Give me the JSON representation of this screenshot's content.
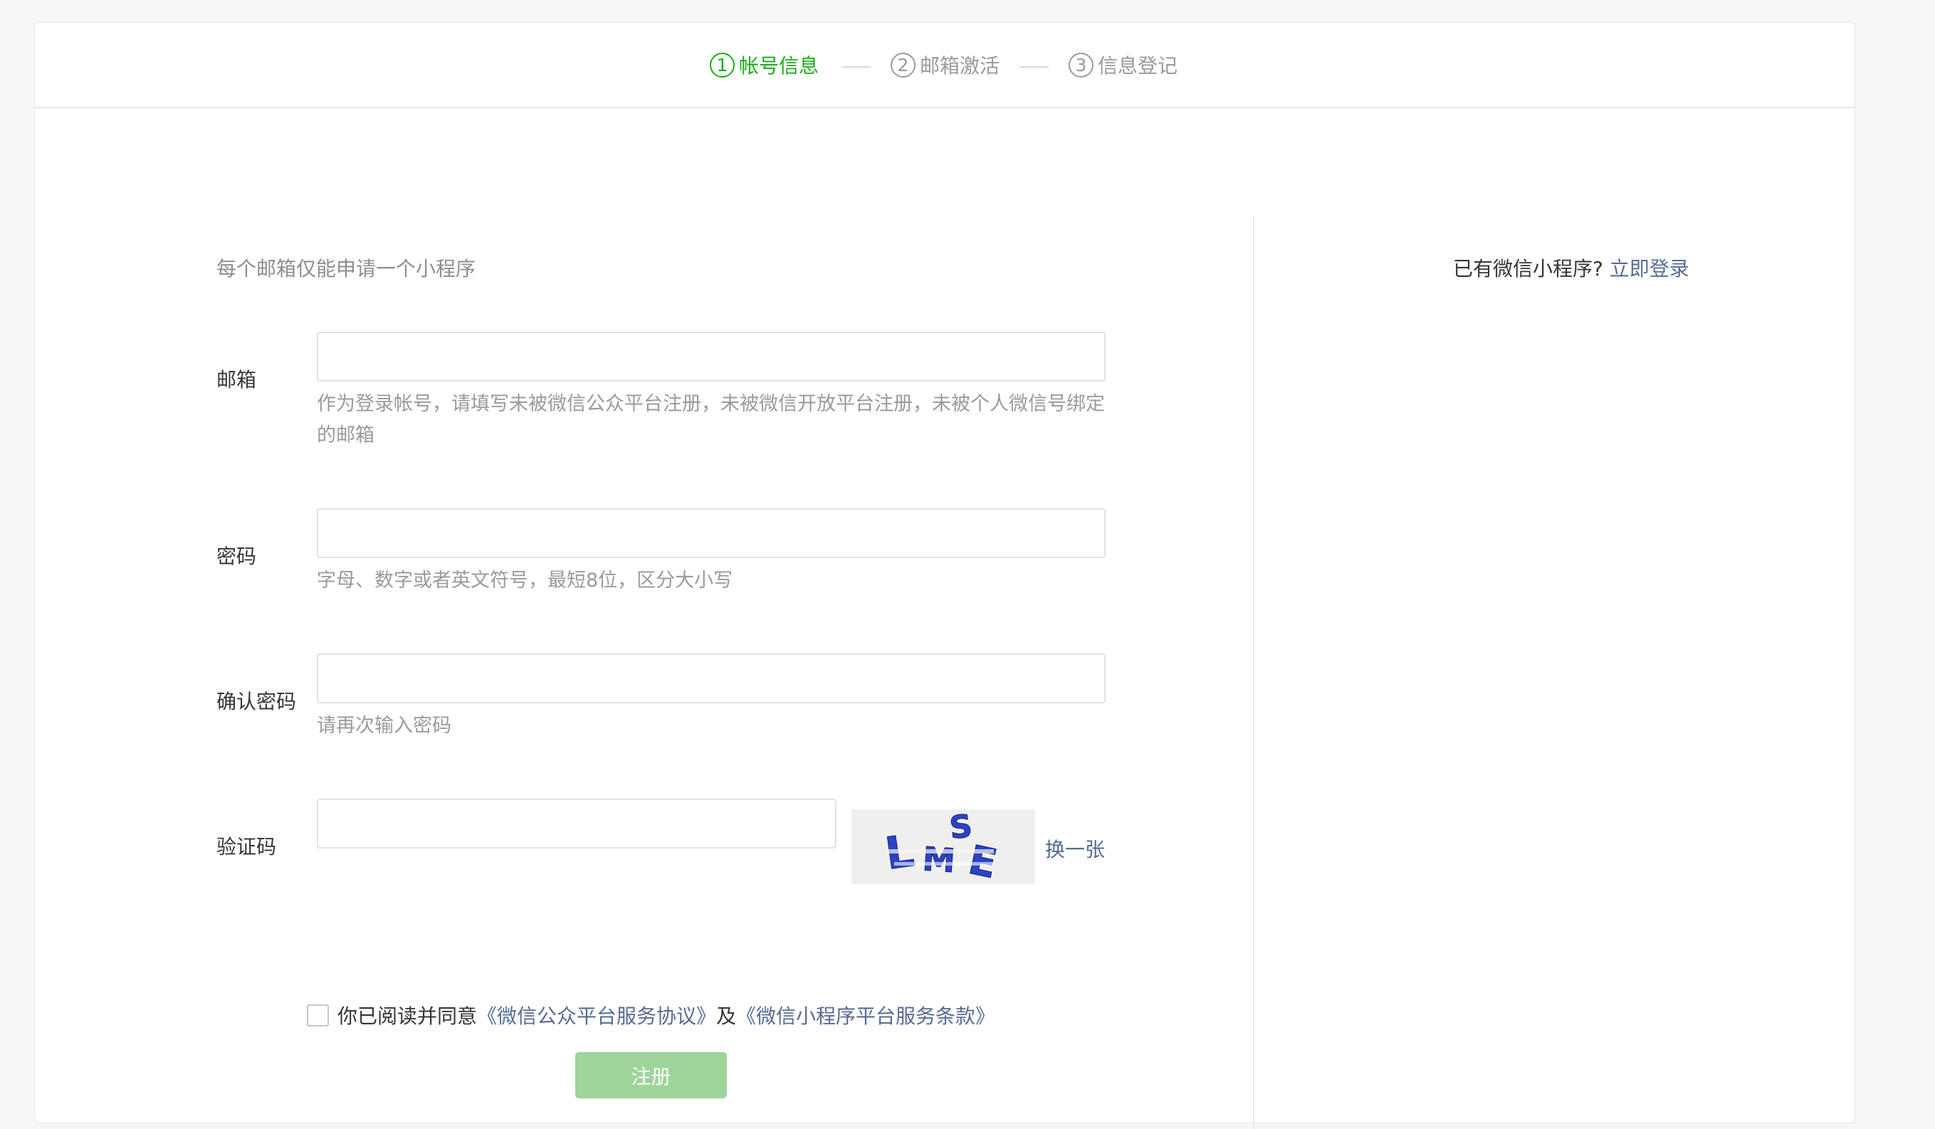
{
  "steps": [
    {
      "num": "1",
      "label": "帐号信息",
      "active": true
    },
    {
      "num": "2",
      "label": "邮箱激活",
      "active": false
    },
    {
      "num": "3",
      "label": "信息登记",
      "active": false
    }
  ],
  "form": {
    "tip": "每个邮箱仅能申请一个小程序",
    "email": {
      "label": "邮箱",
      "value": "",
      "hint": "作为登录帐号，请填写未被微信公众平台注册，未被微信开放平台注册，未被个人微信号绑定的邮箱"
    },
    "password": {
      "label": "密码",
      "value": "",
      "hint": "字母、数字或者英文符号，最短8位，区分大小写"
    },
    "confirm_password": {
      "label": "确认密码",
      "value": "",
      "hint": "请再次输入密码"
    },
    "captcha": {
      "label": "验证码",
      "value": "",
      "image_text": "LMSE",
      "refresh_label": "换一张"
    },
    "agreement": {
      "checked": false,
      "prefix": "你已阅读并同意",
      "link1": "《微信公众平台服务协议》",
      "middle": "及",
      "link2": "《微信小程序平台服务条款》"
    },
    "submit_label": "注册"
  },
  "side": {
    "prompt": "已有微信小程序?",
    "login_link": "立即登录"
  },
  "colors": {
    "active_step": "#1aad19",
    "link": "#576b95",
    "submit_disabled": "#9ed39a"
  }
}
